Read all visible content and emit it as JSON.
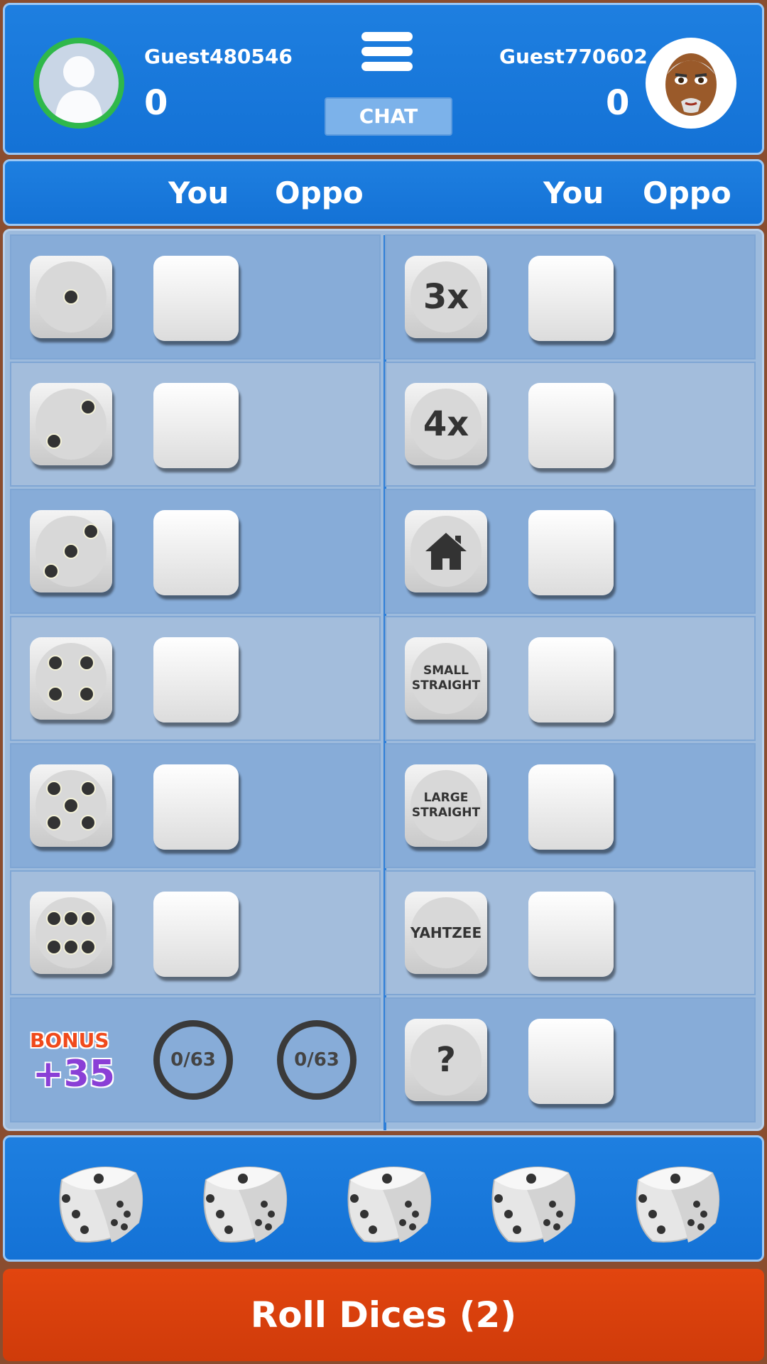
{
  "header": {
    "player_left": {
      "name": "Guest480546",
      "score": "0"
    },
    "player_right": {
      "name": "Guest770602",
      "score": "0"
    },
    "chat_label": "CHAT"
  },
  "column_headers": {
    "left_you": "You",
    "left_oppo": "Oppo",
    "right_you": "You",
    "right_oppo": "Oppo"
  },
  "left_categories": [
    {
      "icon": "die-face-1-icon",
      "pips": 1
    },
    {
      "icon": "die-face-2-icon",
      "pips": 2
    },
    {
      "icon": "die-face-3-icon",
      "pips": 3
    },
    {
      "icon": "die-face-4-icon",
      "pips": 4
    },
    {
      "icon": "die-face-5-icon",
      "pips": 5
    },
    {
      "icon": "die-face-6-icon",
      "pips": 6
    }
  ],
  "right_categories": [
    {
      "label": "3x"
    },
    {
      "label": "4x"
    },
    {
      "label": "",
      "icon": "house-icon"
    },
    {
      "label": "SMALL\nSTRAIGHT"
    },
    {
      "label": "LARGE\nSTRAIGHT"
    },
    {
      "label": "YAHTZEE"
    },
    {
      "label": "?"
    }
  ],
  "bonus": {
    "label": "BONUS",
    "value": "+35",
    "you_progress": "0/63",
    "oppo_progress": "0/63"
  },
  "dice_tray": {
    "count": 5
  },
  "roll_button_label": "Roll Dices (2)",
  "colors": {
    "panel_blue": "#1472d6",
    "board_blue": "#9dbbdd",
    "roll_orange": "#d63d0b",
    "progress_green": "#2fb84a"
  }
}
